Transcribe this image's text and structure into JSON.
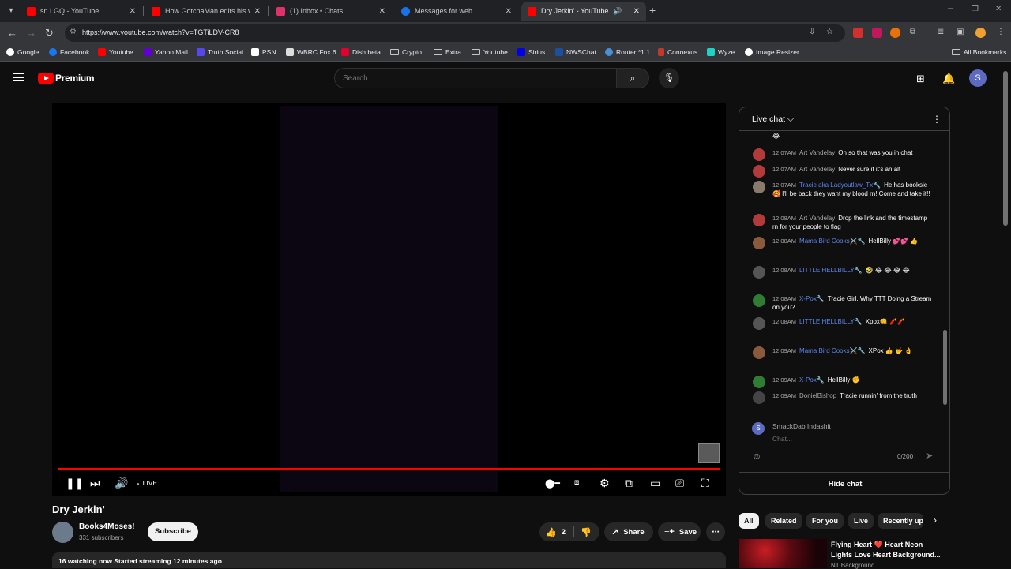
{
  "browser": {
    "tabs": [
      {
        "title": "sn LGQ - YouTube",
        "favicon_color": "#ff0000"
      },
      {
        "title": "How GotchaMan edits his video",
        "favicon_color": "#ff0000"
      },
      {
        "title": "(1) Inbox • Chats",
        "favicon_color": "#e1306c"
      },
      {
        "title": "Messages for web",
        "favicon_color": "#1a73e8"
      },
      {
        "title": "Dry Jerkin' - YouTube",
        "favicon_color": "#ff0000"
      }
    ],
    "url": "https://www.youtube.com/watch?v=TGTiLDV-CR8",
    "bookmarks": [
      {
        "label": "Google",
        "color": "#ffffff"
      },
      {
        "label": "Facebook",
        "color": "#1877f2"
      },
      {
        "label": "Youtube",
        "color": "#ff0000"
      },
      {
        "label": "Yahoo Mail",
        "color": "#6001d2"
      },
      {
        "label": "Truth Social",
        "color": "#5448ee"
      },
      {
        "label": "PSN",
        "color": "#ffffff"
      },
      {
        "label": "WBRC Fox 6",
        "color": "#ffffff"
      },
      {
        "label": "Dish beta",
        "color": "#e4002b"
      },
      {
        "label": "Crypto",
        "color": "folder"
      },
      {
        "label": "Extra",
        "color": "folder"
      },
      {
        "label": "Youtube",
        "color": "folder"
      },
      {
        "label": "Sirius",
        "color": "#0000eb"
      },
      {
        "label": "NWSChat",
        "color": "#1d4fa0"
      },
      {
        "label": "Router *1.1",
        "color": "#4a90d9"
      },
      {
        "label": "Connexus",
        "color": "#c0392b"
      },
      {
        "label": "Wyze",
        "color": "#1ed3c6"
      },
      {
        "label": "Image Resizer",
        "color": "#ffffff"
      }
    ],
    "all_bookmarks": "All Bookmarks"
  },
  "header": {
    "logo_text": "Premium",
    "search_placeholder": "Search",
    "avatar_letter": "S"
  },
  "player": {
    "live_label": "LIVE",
    "progress_fraction": 1.0
  },
  "video": {
    "title": "Dry Jerkin'",
    "channel": "Books4Moses!",
    "subscribers": "331 subscribers",
    "subscribe_label": "Subscribe",
    "likes": "2",
    "share_label": "Share",
    "save_label": "Save",
    "meta": "16 watching now  Started streaming 12 minutes ago"
  },
  "chat": {
    "title": "Live chat",
    "messages": [
      {
        "time": "12:07AM",
        "author": "Art Vandelay",
        "mod": false,
        "text": "Oh so that was you in chat",
        "avatar_color": "#b33a3a"
      },
      {
        "time": "12:07AM",
        "author": "Art Vandelay",
        "mod": false,
        "text": "Never sure if it's an alt",
        "avatar_color": "#b33a3a"
      },
      {
        "time": "12:07AM",
        "author": "Tracie aka Ladyoutlaw_Tx🔧",
        "mod": true,
        "text": "He has booksie 🥰 I'll be back they want my blood rn! Come and take it!!",
        "avatar_color": "#8a7a6a"
      },
      {
        "time": "12:08AM",
        "author": "Art Vandelay",
        "mod": false,
        "text": "Drop the link and the timestamp rn for your people to flag",
        "avatar_color": "#b33a3a"
      },
      {
        "time": "12:08AM",
        "author": "Mama Bird Cooks⚔️🔧",
        "mod": true,
        "text": "HellBilly 💕💕 👍",
        "avatar_color": "#8b5a3c"
      },
      {
        "time": "12:08AM",
        "author": "LITTLE HELLBILLY🔧",
        "mod": true,
        "text": "🤣 😂 😂 😂 😂",
        "avatar_color": "#555555"
      },
      {
        "time": "12:08AM",
        "author": "X-Pox🔧",
        "mod": true,
        "text": "Tracie Girl, Why TTT Doing a Stream on you?",
        "avatar_color": "#2e7d32"
      },
      {
        "time": "12:08AM",
        "author": "LITTLE HELLBILLY🔧",
        "mod": true,
        "text": "Xpox👊 🧨🧨",
        "avatar_color": "#555555"
      },
      {
        "time": "12:09AM",
        "author": "Mama Bird Cooks⚔️🔧",
        "mod": true,
        "text": "XPox 👍 🤟 👌",
        "avatar_color": "#8b5a3c"
      },
      {
        "time": "12:09AM",
        "author": "X-Pox🔧",
        "mod": true,
        "text": "HellBilly ✊",
        "avatar_color": "#2e7d32"
      },
      {
        "time": "12:09AM",
        "author": "DonielBishop",
        "mod": false,
        "text": "Tracie runnin' from the truth",
        "avatar_color": "#444444"
      }
    ],
    "user_name": "SmackDab Indashit",
    "user_initial": "S",
    "input_placeholder": "Chat...",
    "char_count": "0/200",
    "hide_label": "Hide chat"
  },
  "chips": [
    "All",
    "Related",
    "For you",
    "Live",
    "Recently up"
  ],
  "recommendation": {
    "title": "Flying Heart ❤️ Heart Neon Lights Love Heart Background...",
    "channel": "NT Background"
  }
}
